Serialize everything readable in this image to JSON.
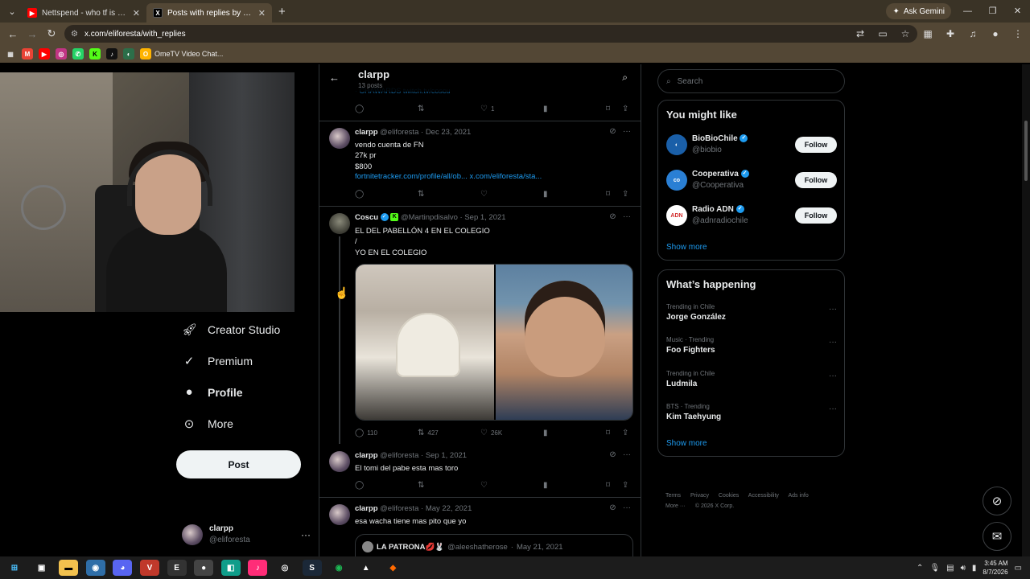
{
  "browser": {
    "tabs": [
      {
        "title": "Nettspend - who tf is u (officia",
        "favicon_color": "#ff0000"
      },
      {
        "title": "Posts with replies by clarpp (@e",
        "favicon_color": "#000000"
      }
    ],
    "ask_gemini": "Ask Gemini",
    "url": "x.com/eliforesta/with_replies",
    "bookmarks": [
      {
        "label": "OmeTV Video Chat..."
      }
    ]
  },
  "left_nav": {
    "items": [
      {
        "label": "Creator Studio",
        "icon": "rocket-icon"
      },
      {
        "label": "Premium",
        "icon": "verified-icon"
      },
      {
        "label": "Profile",
        "icon": "person-icon"
      },
      {
        "label": "More",
        "icon": "more-circle-icon"
      }
    ],
    "post_button": "Post",
    "account": {
      "name": "clarpp",
      "handle": "@eliforesta"
    }
  },
  "timeline": {
    "header": {
      "name": "clarpp",
      "posts_count": "13 posts"
    },
    "peek_link": "· CHAWARDS twitch.tv/coscu",
    "top_actions": {
      "likes": "1"
    },
    "tweets": [
      {
        "name": "clarpp",
        "handle": "@eliforesta",
        "date": "Dec 23, 2021",
        "text": "vendo cuenta de FN\n27k pr\n$800",
        "link": "fortnitetracker.com/profile/all/ob... x.com/eliforesta/sta...",
        "replies": "",
        "retweets": "",
        "likes": ""
      },
      {
        "name": "Coscu",
        "handle": "@Martinpdisalvo",
        "date": "Sep 1, 2021",
        "text": "EL DEL PABELLÓN 4 EN EL COLEGIO\n/\nYO EN EL COLEGIO",
        "replies": "110",
        "retweets": "427",
        "likes": "26K"
      },
      {
        "name": "clarpp",
        "handle": "@eliforesta",
        "date": "Sep 1, 2021",
        "text": "El tomi del pabe esta mas toro",
        "replies": "",
        "retweets": "",
        "likes": ""
      },
      {
        "name": "clarpp",
        "handle": "@eliforesta",
        "date": "May 22, 2021",
        "text": "esa wacha tiene mas pito que yo",
        "quote": {
          "name": "LA PATRONA💋🐰",
          "handle": "@aleeshatherose",
          "date": "May 21, 2021"
        }
      }
    ]
  },
  "sidebar": {
    "search_placeholder": "Search",
    "you_might_like": {
      "title": "You might like",
      "accounts": [
        {
          "name": "BioBioChile",
          "handle": "@biobio",
          "button": "Follow",
          "avatar_color": "#1a5fa8"
        },
        {
          "name": "Cooperativa",
          "handle": "@Cooperativa",
          "button": "Follow",
          "avatar_color": "#2a7fd4"
        },
        {
          "name": "Radio ADN",
          "handle": "@adnradiochile",
          "button": "Follow",
          "avatar_color": "#ffffff"
        }
      ],
      "show_more": "Show more"
    },
    "whats_happening": {
      "title": "What’s happening",
      "trends": [
        {
          "context": "Trending in Chile",
          "topic": "Jorge González"
        },
        {
          "context": "Music · Trending",
          "topic": "Foo Fighters"
        },
        {
          "context": "Trending in Chile",
          "topic": "Ludmila"
        },
        {
          "context": "BTS · Trending",
          "topic": "Kim Taehyung"
        }
      ],
      "show_more": "Show more"
    },
    "footer": {
      "links": [
        "Terms",
        "Privacy",
        "Cookies",
        "Accessibility",
        "Ads info"
      ],
      "more": "More ···",
      "copyright": "© 2026 X Corp."
    }
  },
  "taskbar": {
    "time": "3:45 AM",
    "date": "8/7/2026"
  }
}
